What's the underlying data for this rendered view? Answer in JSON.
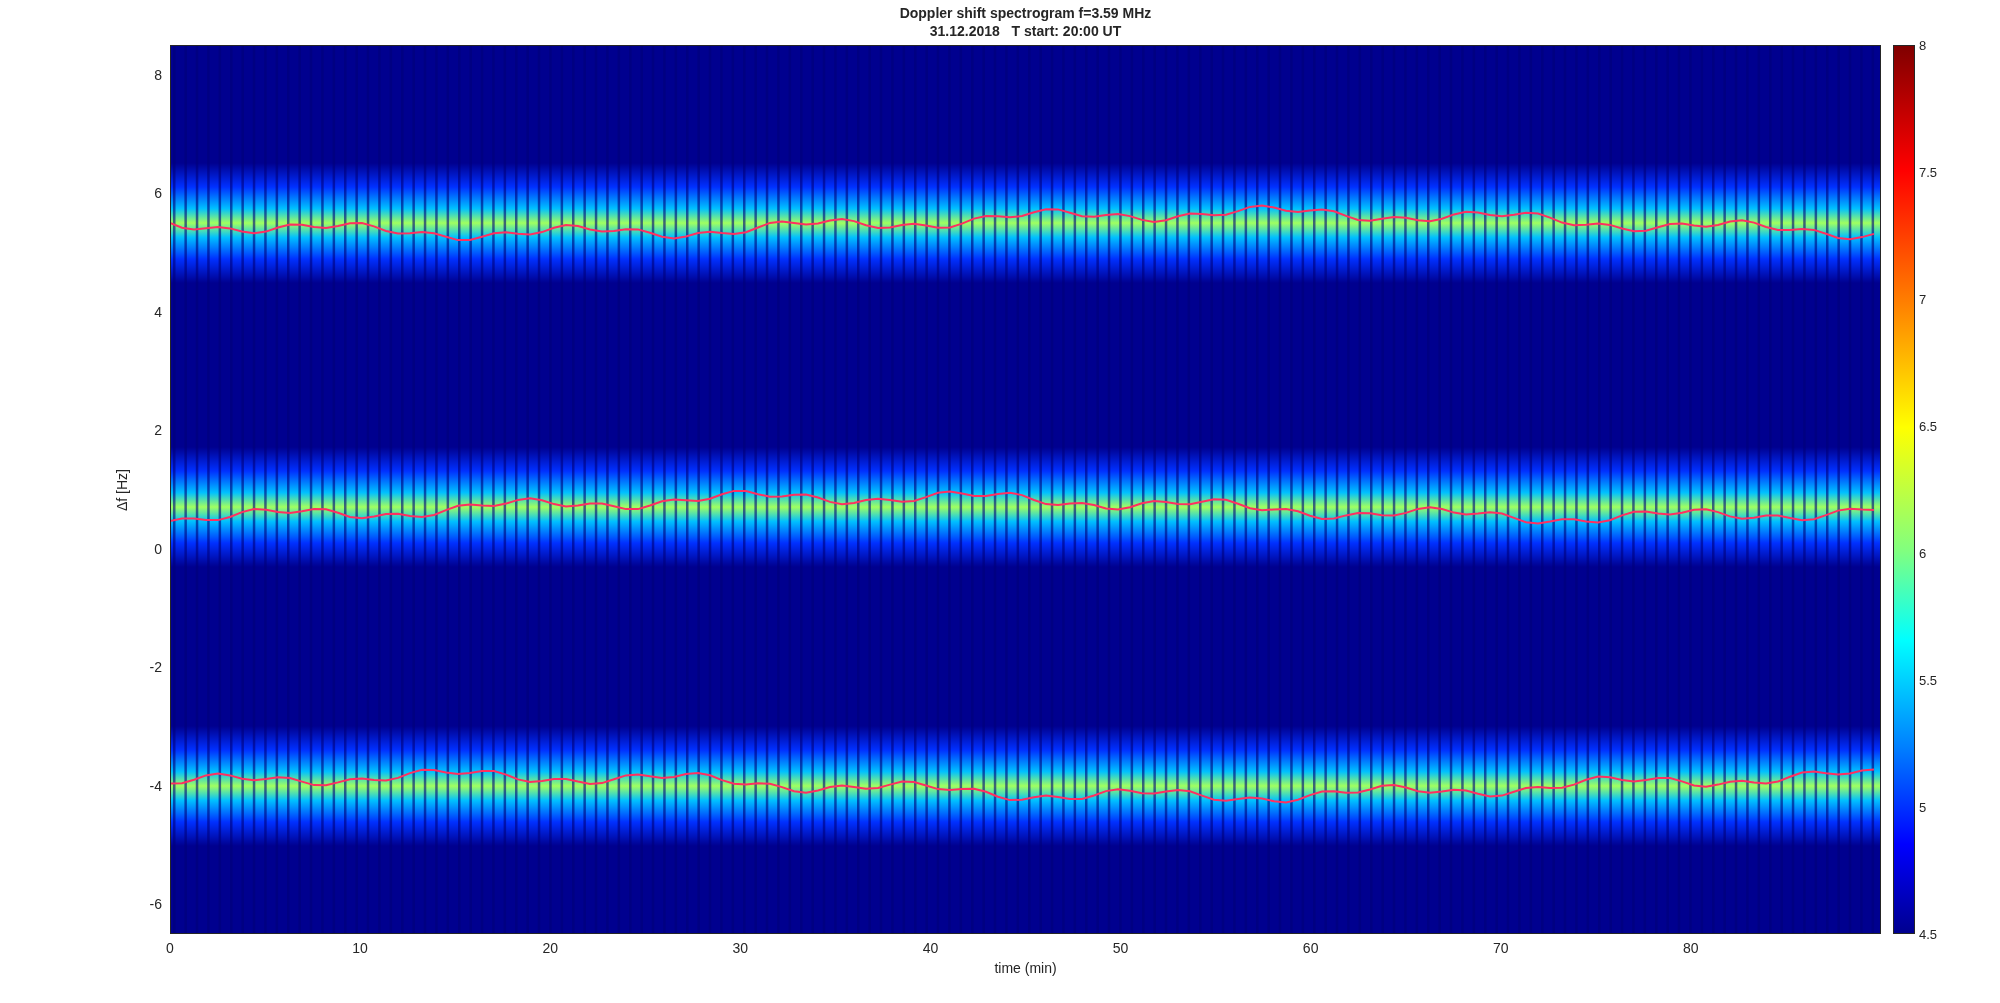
{
  "title": [
    "Doppler shift spectrogram f=3.59 MHz",
    "31.12.2018   T start: 20:00 UT"
  ],
  "ylabel": "Δf [Hz]",
  "xlabel": "time (min)",
  "yticks": [
    "8",
    "6",
    "4",
    "2",
    "0",
    "-2",
    "-4",
    "-6"
  ],
  "xticks": [
    "0",
    "10",
    "20",
    "30",
    "40",
    "50",
    "60",
    "70",
    "80"
  ],
  "colorbar_ticks": [
    "8",
    "7.5",
    "7",
    "6.5",
    "6",
    "5.5",
    "5",
    "4.5"
  ]
}
